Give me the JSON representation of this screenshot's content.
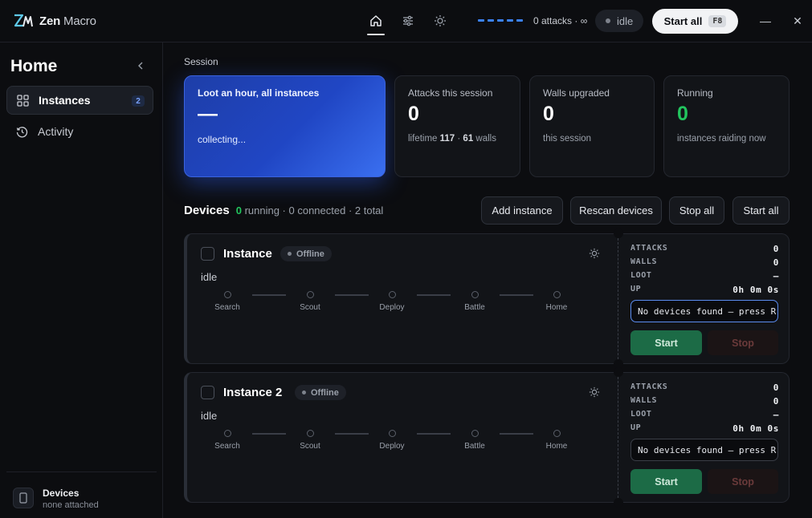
{
  "app": {
    "logo_mark": "ZM",
    "title_bold": "Zen",
    "title_thin": "Macro"
  },
  "topbar": {
    "nav": [
      {
        "icon": "home-icon",
        "active": true
      },
      {
        "icon": "sliders-icon",
        "active": false
      },
      {
        "icon": "sun-icon",
        "active": false
      }
    ],
    "attacks_status": "0 attacks · ∞",
    "idle_label": "idle",
    "start_all_label": "Start all",
    "start_all_key": "F8",
    "minimize_glyph": "—",
    "close_glyph": "✕",
    "accent_color": "#3b82f6"
  },
  "sidebar": {
    "title": "Home",
    "items": [
      {
        "label": "Instances",
        "icon": "grid-icon",
        "badge": "2",
        "active": true
      },
      {
        "label": "Activity",
        "icon": "history-icon",
        "active": false
      }
    ],
    "footer": {
      "title": "Devices",
      "subtitle": "none attached",
      "icon": "phone-icon"
    }
  },
  "session": {
    "label": "Session",
    "cards": [
      {
        "title": "Loot an hour, all instances",
        "value": "—",
        "sub": "collecting..."
      },
      {
        "title": "Attacks this session",
        "value": "0",
        "sub_prefix": "lifetime ",
        "sub_lifetime": "117",
        "sub_mid": " · ",
        "sub_walls": "61",
        "sub_suffix": " walls"
      },
      {
        "title": "Walls upgraded",
        "value": "0",
        "sub": "this session"
      },
      {
        "title": "Running",
        "value": "0",
        "sub": "instances raiding now"
      }
    ]
  },
  "devices": {
    "title": "Devices",
    "running_count": "0",
    "stats_rest": "running · 0 connected · 2 total",
    "buttons": {
      "add": "Add instance",
      "rescan": "Rescan devices",
      "stop_all": "Stop all",
      "start_all": "Start all"
    }
  },
  "instances": [
    {
      "name": "Instance",
      "status": "Offline",
      "state": "idle",
      "steps": [
        "Search",
        "Scout",
        "Deploy",
        "Battle",
        "Home"
      ],
      "stats": {
        "attacks_label": "ATTACKS",
        "attacks": "0",
        "walls_label": "WALLS",
        "walls": "0",
        "loot_label": "LOOT",
        "loot": "—",
        "up_label": "UP",
        "up": "0h 0m 0s"
      },
      "message": "No devices found — press R",
      "start_label": "Start",
      "stop_label": "Stop"
    },
    {
      "name": "Instance 2",
      "status": "Offline",
      "state": "idle",
      "steps": [
        "Search",
        "Scout",
        "Deploy",
        "Battle",
        "Home"
      ],
      "stats": {
        "attacks_label": "ATTACKS",
        "attacks": "0",
        "walls_label": "WALLS",
        "walls": "0",
        "loot_label": "LOOT",
        "loot": "—",
        "up_label": "UP",
        "up": "0h 0m 0s"
      },
      "message": "No devices found — press R",
      "start_label": "Start",
      "stop_label": "Stop"
    }
  ]
}
